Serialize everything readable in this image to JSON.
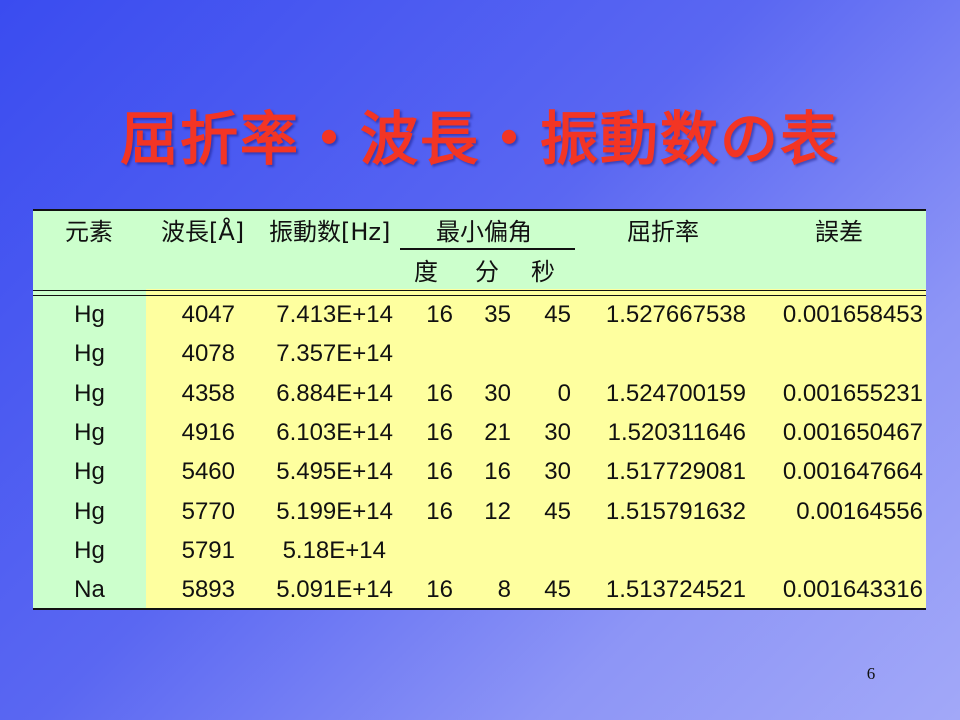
{
  "slide": {
    "title": "屈折率・波長・振動数の表",
    "page_number": "6"
  },
  "table": {
    "headers": {
      "element": "元素",
      "wavelength": "波長[Å]",
      "frequency": "振動数[Hz]",
      "min_deviation": "最小偏角",
      "degree": "度",
      "minute": "分",
      "second": "秒",
      "refractive_index": "屈折率",
      "error": "誤差"
    },
    "rows": [
      {
        "element": "Hg",
        "wavelength": "4047",
        "frequency": "7.413E+14",
        "degree": "16",
        "minute": "35",
        "second": "45",
        "refractive_index": "1.527667538",
        "error": "0.001658453"
      },
      {
        "element": "Hg",
        "wavelength": "4078",
        "frequency": "7.357E+14",
        "degree": "",
        "minute": "",
        "second": "",
        "refractive_index": "",
        "error": ""
      },
      {
        "element": "Hg",
        "wavelength": "4358",
        "frequency": "6.884E+14",
        "degree": "16",
        "minute": "30",
        "second": "0",
        "refractive_index": "1.524700159",
        "error": "0.001655231"
      },
      {
        "element": "Hg",
        "wavelength": "4916",
        "frequency": "6.103E+14",
        "degree": "16",
        "minute": "21",
        "second": "30",
        "refractive_index": "1.520311646",
        "error": "0.001650467"
      },
      {
        "element": "Hg",
        "wavelength": "5460",
        "frequency": "5.495E+14",
        "degree": "16",
        "minute": "16",
        "second": "30",
        "refractive_index": "1.517729081",
        "error": "0.001647664"
      },
      {
        "element": "Hg",
        "wavelength": "5770",
        "frequency": "5.199E+14",
        "degree": "16",
        "minute": "12",
        "second": "45",
        "refractive_index": "1.515791632",
        "error": "0.00164556"
      },
      {
        "element": "Hg",
        "wavelength": "5791",
        "frequency": "5.18E+14",
        "degree": "",
        "minute": "",
        "second": "",
        "refractive_index": "",
        "error": ""
      },
      {
        "element": "Na",
        "wavelength": "5893",
        "frequency": "5.091E+14",
        "degree": "16",
        "minute": "8",
        "second": "45",
        "refractive_index": "1.513724521",
        "error": "0.001643316"
      }
    ]
  }
}
